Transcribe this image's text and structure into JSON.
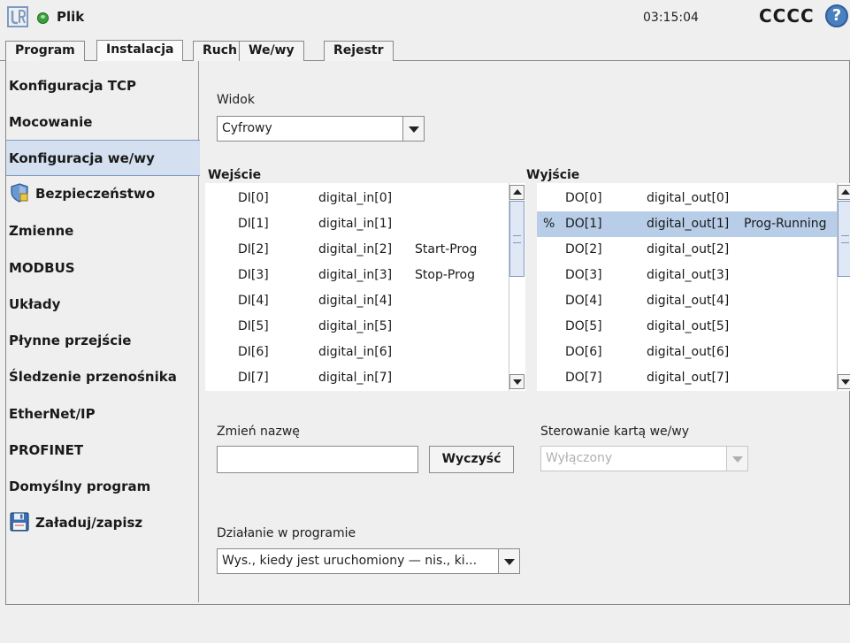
{
  "titlebar": {
    "file_menu": "Plik",
    "clock": "03:15:04",
    "robot_name": "CCCC",
    "help": "?"
  },
  "tabs": [
    {
      "label": "Program",
      "active": false
    },
    {
      "label": "Instalacja",
      "active": true
    },
    {
      "label": "Ruch",
      "active": false
    },
    {
      "label": "We/wy",
      "active": false
    },
    {
      "label": "Rejestr",
      "active": false
    }
  ],
  "sidebar": {
    "items": [
      {
        "label": "Konfiguracja TCP"
      },
      {
        "label": "Mocowanie"
      },
      {
        "label": "Konfiguracja we/wy",
        "selected": true
      },
      {
        "label": "Bezpieczeństwo",
        "icon": "shield-icon"
      },
      {
        "label": "Zmienne"
      },
      {
        "label": "MODBUS"
      },
      {
        "label": "Układy"
      },
      {
        "label": "Płynne przejście"
      },
      {
        "label": "Śledzenie przenośnika"
      },
      {
        "label": "EtherNet/IP"
      },
      {
        "label": "PROFINET"
      },
      {
        "label": "Domyślny program"
      },
      {
        "label": "Załaduj/zapisz",
        "icon": "floppy-disk-icon"
      }
    ]
  },
  "view": {
    "label": "Widok",
    "value": "Cyfrowy"
  },
  "inputs": {
    "title": "Wejście",
    "rows": [
      {
        "id": "DI[0]",
        "name": "digital_in[0]",
        "function": ""
      },
      {
        "id": "DI[1]",
        "name": "digital_in[1]",
        "function": ""
      },
      {
        "id": "DI[2]",
        "name": "digital_in[2]",
        "function": "Start-Prog"
      },
      {
        "id": "DI[3]",
        "name": "digital_in[3]",
        "function": "Stop-Prog"
      },
      {
        "id": "DI[4]",
        "name": "digital_in[4]",
        "function": ""
      },
      {
        "id": "DI[5]",
        "name": "digital_in[5]",
        "function": ""
      },
      {
        "id": "DI[6]",
        "name": "digital_in[6]",
        "function": ""
      },
      {
        "id": "DI[7]",
        "name": "digital_in[7]",
        "function": ""
      }
    ]
  },
  "outputs": {
    "title": "Wyjście",
    "rows": [
      {
        "marker": "",
        "id": "DO[0]",
        "name": "digital_out[0]",
        "function": ""
      },
      {
        "marker": "%",
        "id": "DO[1]",
        "name": "digital_out[1]",
        "function": "Prog-Running",
        "selected": true
      },
      {
        "marker": "",
        "id": "DO[2]",
        "name": "digital_out[2]",
        "function": ""
      },
      {
        "marker": "",
        "id": "DO[3]",
        "name": "digital_out[3]",
        "function": ""
      },
      {
        "marker": "",
        "id": "DO[4]",
        "name": "digital_out[4]",
        "function": ""
      },
      {
        "marker": "",
        "id": "DO[5]",
        "name": "digital_out[5]",
        "function": ""
      },
      {
        "marker": "",
        "id": "DO[6]",
        "name": "digital_out[6]",
        "function": ""
      },
      {
        "marker": "",
        "id": "DO[7]",
        "name": "digital_out[7]",
        "function": ""
      }
    ]
  },
  "rename": {
    "label": "Zmień nazwę",
    "value": "",
    "clear_button": "Wyczyść"
  },
  "io_card_control": {
    "label": "Sterowanie kartą we/wy",
    "value": "Wyłączony",
    "disabled": true
  },
  "program_action": {
    "label": "Działanie w programie",
    "value": "Wys., kiedy jest uruchomiony — nis., ki..."
  },
  "colors": {
    "selected_row": "#b7cde8",
    "selected_nav": "#d4e0ef",
    "status_ok": "#3aa13a",
    "help": "#4a7fc0"
  }
}
